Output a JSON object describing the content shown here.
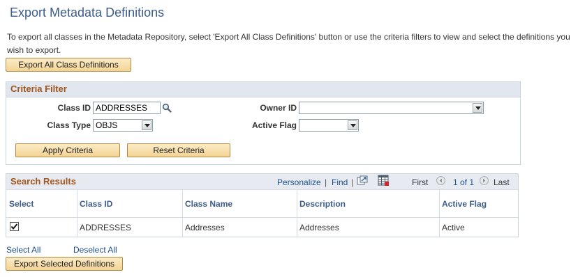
{
  "page": {
    "title": "Export Metadata Definitions",
    "intro": "To export all classes in the Metadata Repository, select 'Export All Class Definitions' button or use the criteria filters to view and select the definitions you wish to export.",
    "export_all_label": "Export All Class Definitions"
  },
  "criteria": {
    "header": "Criteria Filter",
    "class_id_label": "Class ID",
    "class_id_value": "ADDRESSES",
    "owner_id_label": "Owner ID",
    "owner_id_value": "",
    "class_type_label": "Class Type",
    "class_type_value": "OBJS",
    "active_flag_label": "Active Flag",
    "active_flag_value": "",
    "apply_label": "Apply Criteria",
    "reset_label": "Reset Criteria"
  },
  "results": {
    "header": "Search Results",
    "personalize": "Personalize",
    "sep1": "|",
    "find": "Find",
    "sep2": "|",
    "first": "First",
    "range": "1 of 1",
    "last": "Last",
    "columns": [
      "Select",
      "Class ID",
      "Class Name",
      "Description",
      "Active Flag"
    ],
    "rows": [
      {
        "selected": true,
        "class_id": "ADDRESSES",
        "class_name": "Addresses",
        "description": "Addresses",
        "active_flag": "Active"
      }
    ]
  },
  "footer": {
    "select_all": "Select All",
    "deselect_all": "Deselect All",
    "export_selected": "Export Selected Definitions"
  },
  "colors": {
    "title": "#3d5c8b",
    "group_header_text": "#a1541b",
    "link": "#1d4f8c",
    "button_fill": "#f4d393"
  }
}
